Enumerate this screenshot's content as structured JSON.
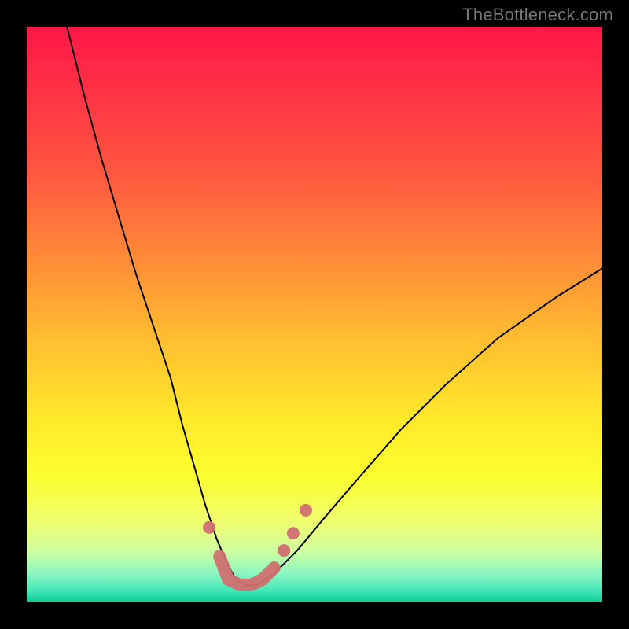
{
  "watermark": "TheBottleneck.com",
  "colors": {
    "frame": "#000000",
    "curve": "#000000",
    "marker": "#d07070",
    "gradient": [
      "#ff1746",
      "#ff2a46",
      "#ff5640",
      "#ff8a38",
      "#ffc030",
      "#ffe82a",
      "#fbff2e",
      "#effd6f",
      "#d0ffa0",
      "#8cf7c0",
      "#44e6b8",
      "#0acc96"
    ]
  },
  "chart_data": {
    "type": "line",
    "title": "",
    "xlabel": "",
    "ylabel": "",
    "xlim": [
      0,
      100
    ],
    "ylim": [
      0,
      100
    ],
    "grid": false,
    "legend": false,
    "series": [
      {
        "name": "bottleneck-curve",
        "x": [
          7,
          10,
          13,
          16,
          19,
          22,
          25,
          27,
          29,
          31,
          33,
          34.7,
          36.3,
          38,
          40,
          43,
          47,
          52,
          58,
          65,
          73,
          82,
          92,
          100
        ],
        "y": [
          100,
          88,
          77,
          67,
          57,
          48,
          39,
          31,
          24,
          17,
          11,
          7,
          4,
          3,
          3,
          5,
          9,
          15,
          22,
          30,
          38,
          46,
          53,
          58
        ]
      }
    ],
    "highlighted_region": {
      "comment": "pink rounded segment near trough plus adjacent dots",
      "trough_path_x": [
        33.5,
        35,
        37,
        39,
        41,
        43
      ],
      "trough_path_y": [
        8,
        4,
        3,
        3,
        4,
        6
      ],
      "dots": [
        {
          "x": 31.7,
          "y": 13
        },
        {
          "x": 44.7,
          "y": 9
        },
        {
          "x": 46.3,
          "y": 12
        },
        {
          "x": 48.5,
          "y": 16
        }
      ]
    }
  }
}
